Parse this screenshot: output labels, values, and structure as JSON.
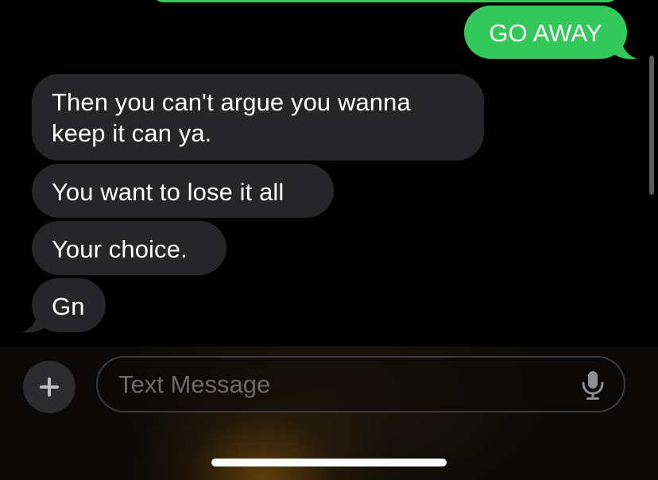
{
  "thread": {
    "outgoing": [
      {
        "text": "GO AWAY"
      }
    ],
    "incoming": [
      {
        "lines": [
          "Then you can't argue you wanna",
          "keep it can ya."
        ]
      },
      {
        "text": "You want to lose it all"
      },
      {
        "text": "Your choice."
      },
      {
        "text": "Gn"
      }
    ]
  },
  "composer": {
    "placeholder": "Text Message",
    "plus_icon": "plus-icon",
    "mic_icon": "microphone-icon"
  },
  "colors": {
    "outgoing_bubble": "#34c759",
    "incoming_bubble": "#262628",
    "background": "#000000",
    "placeholder": "#6b6a6e"
  }
}
